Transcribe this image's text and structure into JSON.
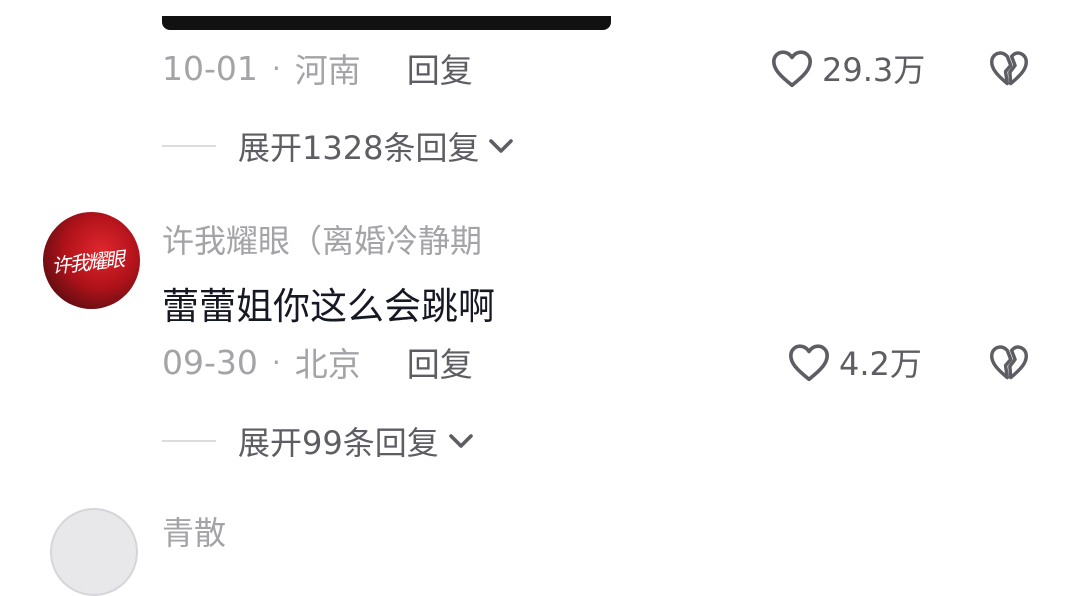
{
  "comment1": {
    "date": "10-01",
    "separator": "·",
    "location": "河南",
    "reply_label": "回复",
    "likes": "29.3万",
    "expand_label": "展开1328条回复"
  },
  "comment2": {
    "username": "许我耀眼（离婚冷静期",
    "avatar_signature": "许我耀眼",
    "text": "蕾蕾姐你这么会跳啊",
    "date": "09-30",
    "separator": "·",
    "location": "北京",
    "reply_label": "回复",
    "likes": "4.2万",
    "expand_label": "展开99条回复"
  },
  "comment3": {
    "username": "青散"
  },
  "colors": {
    "meta_gray": "#a3a3a8",
    "action_gray": "#5d5d63",
    "text_dark": "#161823",
    "avatar_red": "#e0262d"
  },
  "icons": {
    "like": "heart-outline-icon",
    "dislike": "broken-heart-icon",
    "expand": "chevron-down-icon"
  }
}
